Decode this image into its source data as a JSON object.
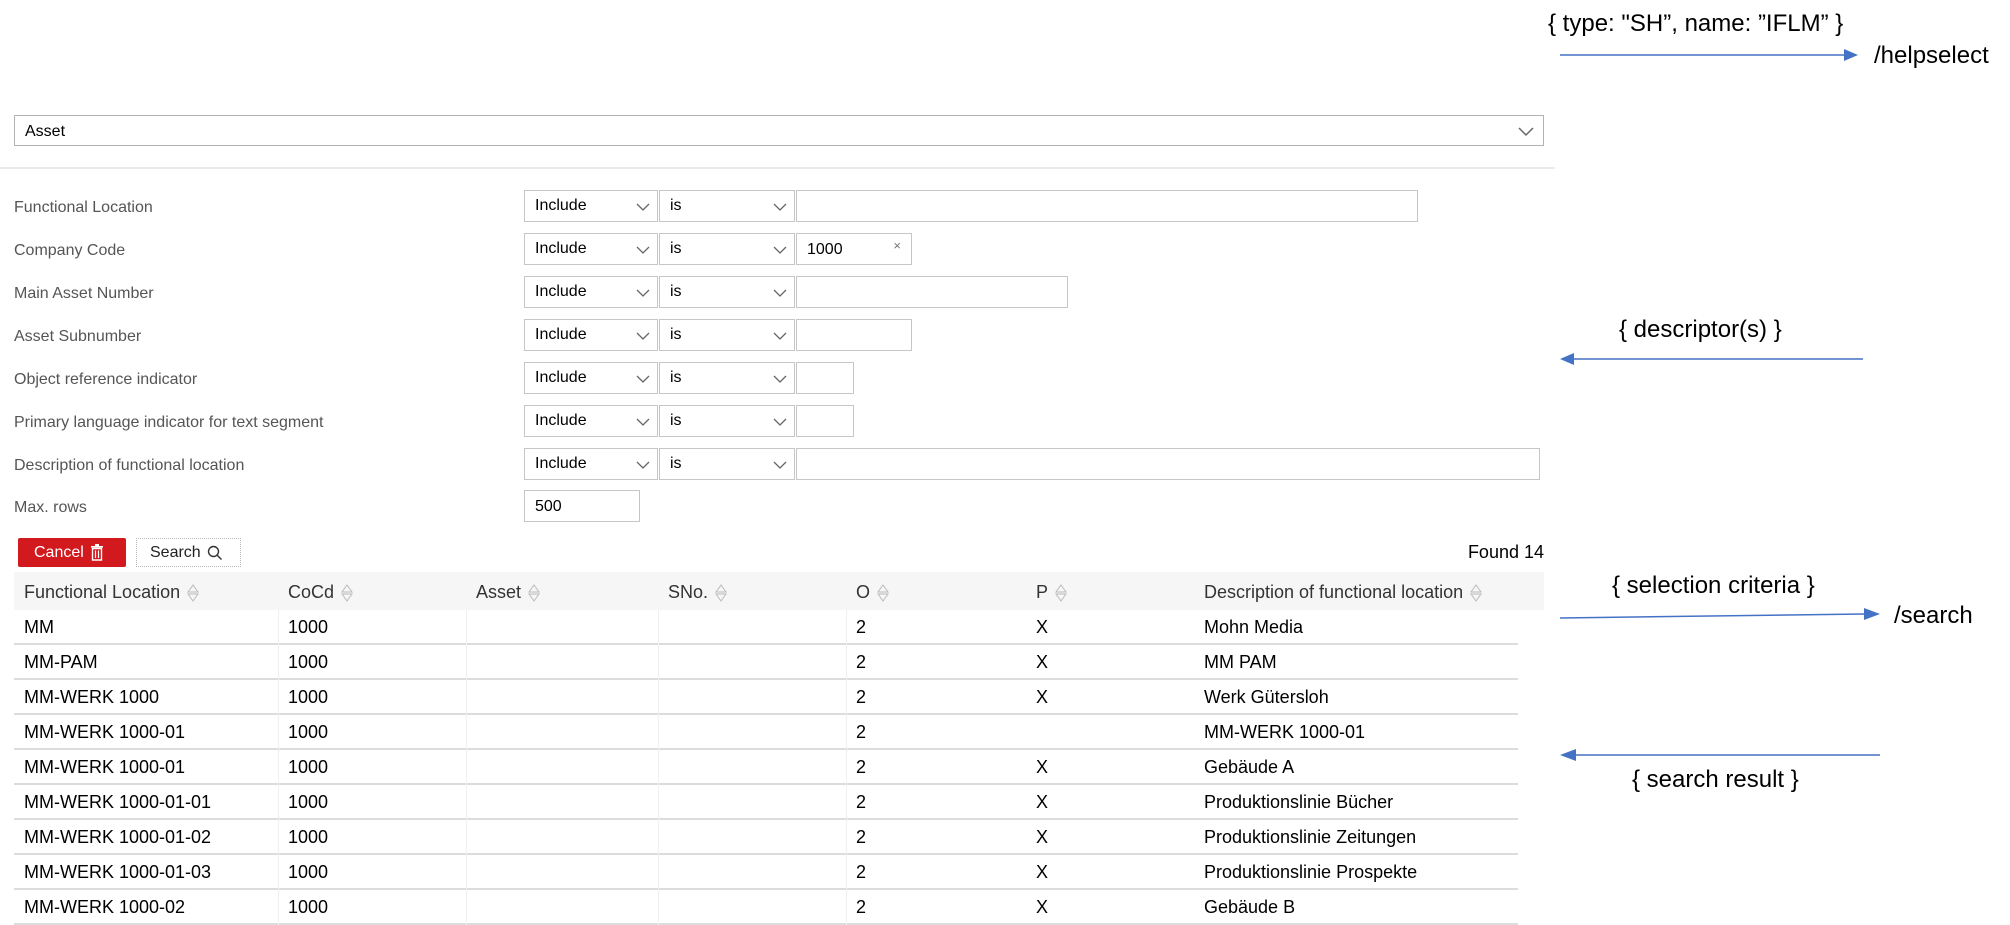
{
  "helpselect": {
    "selected": "Asset"
  },
  "criteria": [
    {
      "label": "Functional Location",
      "sign": "Include",
      "option": "is",
      "value": "",
      "clearable": false
    },
    {
      "label": "Company Code",
      "sign": "Include",
      "option": "is",
      "value": "1000",
      "clearable": true
    },
    {
      "label": "Main Asset Number",
      "sign": "Include",
      "option": "is",
      "value": "",
      "clearable": false
    },
    {
      "label": "Asset Subnumber",
      "sign": "Include",
      "option": "is",
      "value": "",
      "clearable": false
    },
    {
      "label": "Object reference indicator",
      "sign": "Include",
      "option": "is",
      "value": "",
      "clearable": false
    },
    {
      "label": "Primary language indicator for text segment",
      "sign": "Include",
      "option": "is",
      "value": "",
      "clearable": false
    },
    {
      "label": "Description of functional location",
      "sign": "Include",
      "option": "is",
      "value": "",
      "clearable": false
    }
  ],
  "max_rows": {
    "label": "Max. rows",
    "value": "500"
  },
  "buttons": {
    "cancel": "Cancel",
    "search": "Search"
  },
  "found_text": "Found 14",
  "table": {
    "columns": [
      "Functional Location",
      "CoCd",
      "Asset",
      "SNo.",
      "O",
      "P",
      "Description of functional location"
    ],
    "rows": [
      [
        "MM",
        "1000",
        "",
        "",
        "2",
        "X",
        "Mohn Media"
      ],
      [
        "MM-PAM",
        "1000",
        "",
        "",
        "2",
        "X",
        "MM PAM"
      ],
      [
        "MM-WERK 1000",
        "1000",
        "",
        "",
        "2",
        "X",
        "Werk Gütersloh"
      ],
      [
        "MM-WERK 1000-01",
        "1000",
        "",
        "",
        "2",
        "",
        "MM-WERK 1000-01"
      ],
      [
        "MM-WERK 1000-01",
        "1000",
        "",
        "",
        "2",
        "X",
        "Gebäude A"
      ],
      [
        "MM-WERK 1000-01-01",
        "1000",
        "",
        "",
        "2",
        "X",
        "Produktionslinie Bücher"
      ],
      [
        "MM-WERK 1000-01-02",
        "1000",
        "",
        "",
        "2",
        "X",
        "Produktionslinie Zeitungen"
      ],
      [
        "MM-WERK 1000-01-03",
        "1000",
        "",
        "",
        "2",
        "X",
        "Produktionslinie Prospekte"
      ],
      [
        "MM-WERK 1000-02",
        "1000",
        "",
        "",
        "2",
        "X",
        "Gebäude B"
      ]
    ]
  },
  "annotations": {
    "request1": "{  type: \"SH”, name: ”IFLM” }",
    "endpoint1": "/helpselect",
    "response1": "{ descriptor(s) }",
    "request2": "{ selection criteria }",
    "endpoint2": "/search",
    "response2": "{ search result }",
    "arrow_color": "#4472c4"
  }
}
